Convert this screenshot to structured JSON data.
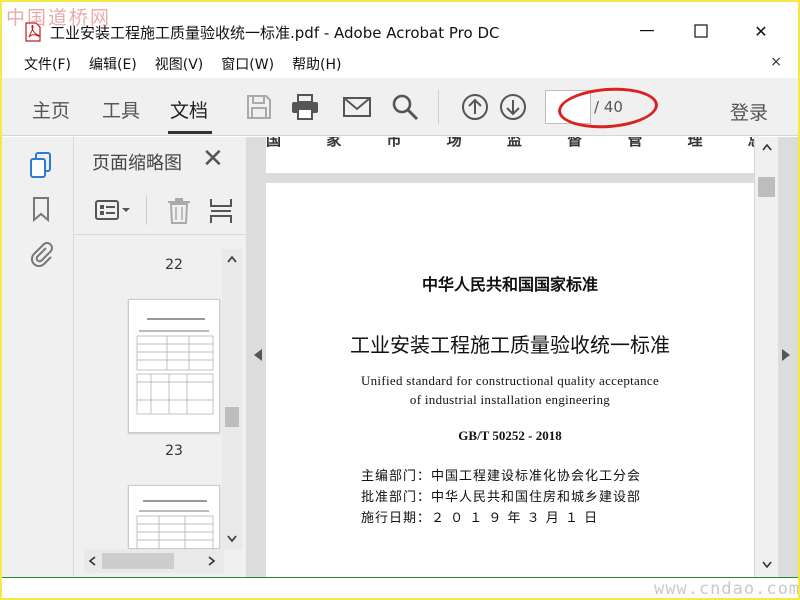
{
  "watermarks": {
    "top_left": "中国道桥网",
    "bottom_right": "www.cndao.com"
  },
  "window": {
    "title": "工业安装工程施工质量验收统一标准.pdf - Adobe Acrobat Pro DC",
    "minimize_icon": "minimize-icon",
    "maximize_icon": "maximize-icon",
    "close_label": "✕"
  },
  "menu": {
    "items": [
      "文件(F)",
      "编辑(E)",
      "视图(V)",
      "窗口(W)",
      "帮助(H)"
    ],
    "close_label": "×"
  },
  "toolbar": {
    "tabs": [
      "主页",
      "工具",
      "文档"
    ],
    "active_tab": "文档",
    "icons": [
      "save-icon",
      "print-icon",
      "email-icon",
      "search-icon",
      "previous-page-icon",
      "next-page-icon"
    ],
    "current_page": "",
    "total_pages": "/ 40",
    "login_label": "登录",
    "highlight_color": "#d9221e"
  },
  "rail": {
    "icons": [
      "page-thumbnails-icon",
      "bookmark-icon",
      "attachment-icon"
    ],
    "accent_color": "#2c7bd1"
  },
  "thumbnails": {
    "title": "页面缩略图",
    "close_label": "✕",
    "tools": [
      "thumbnail-options-icon",
      "delete-page-icon",
      "extract-page-icon"
    ],
    "page_labels": [
      "22",
      "23"
    ]
  },
  "document": {
    "prev_page_strip": "国 家 市 场 监 督 管 理 总 局",
    "org_heading": "中华人民共和国国家标准",
    "title": "工业安装工程施工质量验收统一标准",
    "english_line1": "Unified standard for constructional quality acceptance",
    "english_line2": "of industrial installation engineering",
    "code": "GB/T 50252 - 2018",
    "meta": [
      {
        "label": "主编部门：",
        "value": "中国工程建设标准化协会化工分会"
      },
      {
        "label": "批准部门：",
        "value": "中华人民共和国住房和城乡建设部"
      },
      {
        "label": "施行日期：",
        "value": "２ ０ １ ９ 年 ３ 月 １ 日"
      }
    ]
  }
}
